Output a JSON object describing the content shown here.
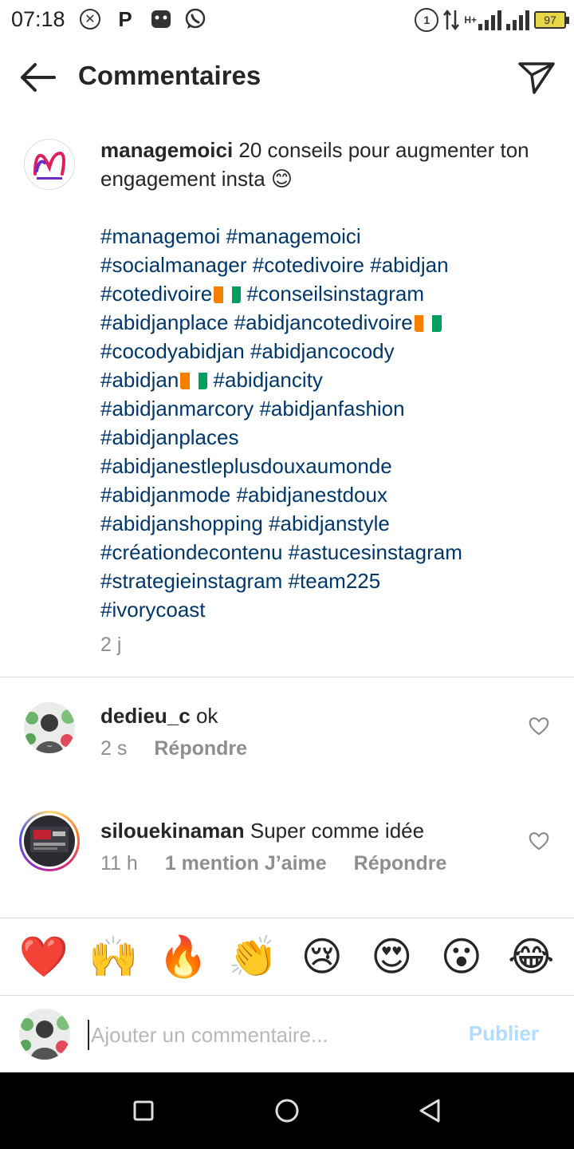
{
  "status_bar": {
    "time": "07:18",
    "left_icons": [
      "close-circle-icon",
      "p-icon",
      "gamepad-icon",
      "whatsapp-icon"
    ],
    "hd_label": "1",
    "network": "H+",
    "battery": "97"
  },
  "header": {
    "title": "Commentaires"
  },
  "post": {
    "username": "managemoici",
    "text": "20 conseils pour augmenter ton engagement insta 😊",
    "hashtag_lines": [
      "#managemoi #managemoici",
      "#socialmanager #cotedivoire #abidjan",
      "#cotedivoire🇨🇮 #conseilsinstagram",
      "#abidjanplace #abidjancotedivoire🇨🇮",
      "#cocodyabidjan #abidjancocody",
      "#abidjan🇨🇮 #abidjancity",
      "#abidjanmarcory #abidjanfashion",
      "#abidjanplaces",
      "#abidjanestleplusdouxaumonde",
      "#abidjanmode #abidjanestdoux",
      "#abidjanshopping #abidjanstyle",
      "#créationdecontenu #astucesinstagram",
      "#strategieinstagram #team225",
      "#ivorycoast"
    ],
    "time": "2 j"
  },
  "comments": [
    {
      "username": "dedieu_c",
      "text": "ok",
      "time": "2 s",
      "likes": "",
      "reply": "Répondre"
    },
    {
      "username": "silouekinaman",
      "text": "Super comme idée",
      "time": "11 h",
      "likes": "1 mention J’aime",
      "reply": "Répondre"
    }
  ],
  "reactions": [
    "❤️",
    "🙌",
    "🔥",
    "👏",
    "😢",
    "😍",
    "😮",
    "😂"
  ],
  "reaction_names": [
    "heart",
    "raised-hands",
    "fire",
    "clapping-hands",
    "crying-face",
    "heart-eyes",
    "surprised-face",
    "tears-of-joy"
  ],
  "composer": {
    "placeholder": "Ajouter un commentaire...",
    "publish_label": "Publier"
  },
  "colors": {
    "hashtag": "#00376b",
    "muted": "#8e8e8e",
    "publish_disabled": "#b3dbff",
    "nav_bar": "#000000"
  }
}
